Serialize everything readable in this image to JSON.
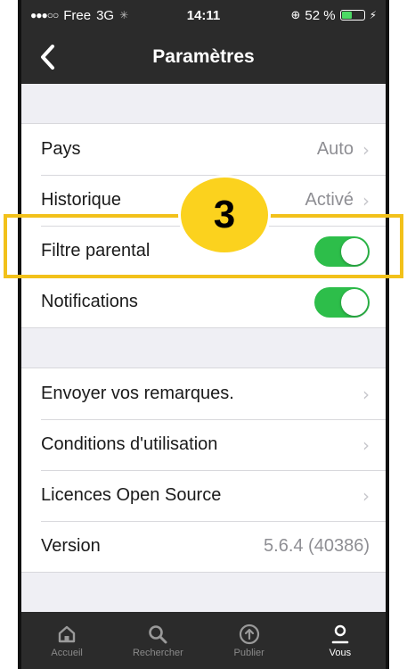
{
  "status_bar": {
    "carrier": "Free",
    "network": "3G",
    "time": "14:11",
    "battery": "52 %",
    "battery_level": 0.52
  },
  "nav": {
    "title": "Paramètres"
  },
  "settings_group_1": [
    {
      "label": "Pays",
      "value": "Auto"
    },
    {
      "label": "Historique",
      "value": "Activé"
    },
    {
      "label": "Filtre parental",
      "toggle": true
    },
    {
      "label": "Notifications",
      "toggle": true
    }
  ],
  "settings_group_2": [
    {
      "label": "Envoyer vos remarques."
    },
    {
      "label": "Conditions d'utilisation"
    },
    {
      "label": "Licences Open Source"
    },
    {
      "label": "Version",
      "value": "5.6.4 (40386)"
    }
  ],
  "tab_bar": {
    "tabs": [
      {
        "label": "Accueil",
        "icon": "home-icon"
      },
      {
        "label": "Rechercher",
        "icon": "search-icon"
      },
      {
        "label": "Publier",
        "icon": "upload-icon"
      },
      {
        "label": "Vous",
        "icon": "user-icon",
        "active": true
      }
    ]
  },
  "annotation": {
    "step": "3"
  },
  "colors": {
    "bar_bg": "#2b2b2b",
    "toggle_on": "#2dbe4a",
    "highlight": "#f2c11a",
    "badge": "#fbd21e"
  }
}
